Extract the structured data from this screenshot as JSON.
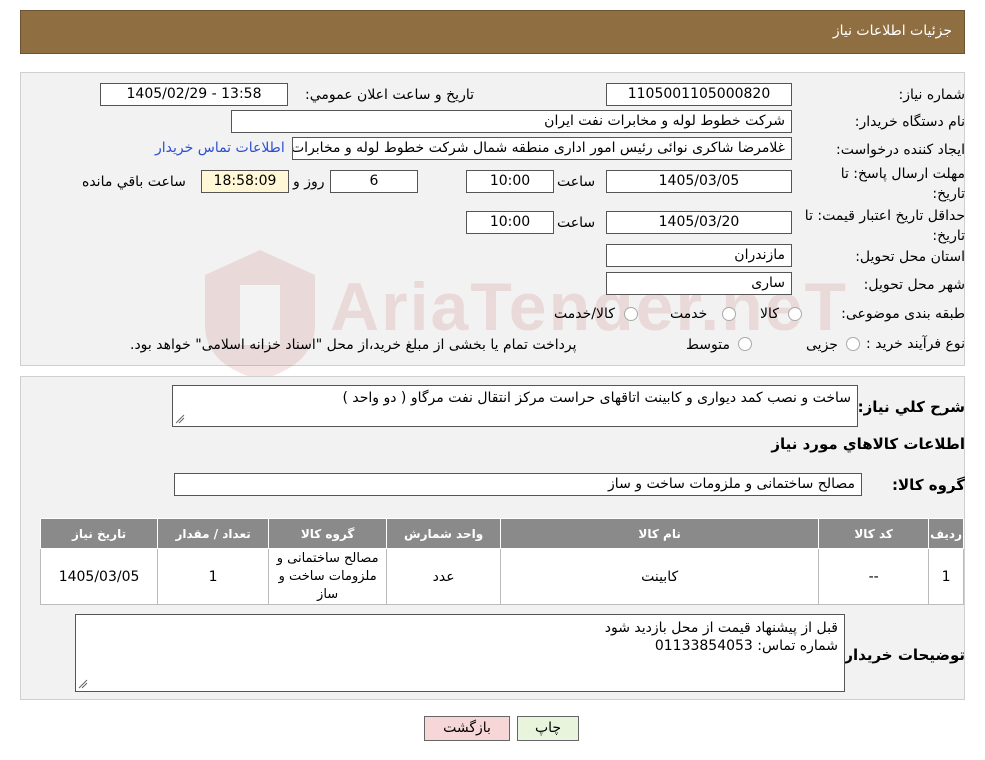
{
  "header": {
    "title": "جزئیات اطلاعات نیاز"
  },
  "form": {
    "need_number_label": "شماره نیاز:",
    "need_number": "1105001105000820",
    "announce_label": "تاریخ و ساعت اعلان عمومي:",
    "announce_value": "1405/02/29 - 13:58",
    "buyer_org_label": "نام دستگاه خریدار:",
    "buyer_org": "شرکت خطوط لوله و مخابرات نفت ایران",
    "requester_label": "ایجاد کننده درخواست:",
    "requester": "غلامرضا شاکری نوائی رئیس امور اداری منطقه شمال  شرکت خطوط لوله و مخابرات نفت ایران",
    "contact_link": "اطلاعات تماس خریدار",
    "deadline_label": "مهلت ارسال پاسخ: تا تاریخ:",
    "deadline_date": "1405/03/05",
    "time_label": "ساعت",
    "deadline_time": "10:00",
    "days_value": "6",
    "days_label": "روز و",
    "remaining_time": "18:58:09",
    "remaining_label": "ساعت باقي مانده",
    "validity_label": "حداقل تاریخ اعتبار قیمت: تا تاریخ:",
    "validity_date": "1405/03/20",
    "validity_time": "10:00",
    "province_label": "استان محل تحویل:",
    "province": "مازندران",
    "city_label": "شهر محل تحویل:",
    "city": "ساری",
    "category_label": "طبقه بندی موضوعی:",
    "category_options": [
      "کالا",
      "خدمت",
      "کالا/خدمت"
    ],
    "process_label": "نوع فرآیند خرید :",
    "process_options": [
      "جزیی",
      "متوسط"
    ],
    "process_note": "پرداخت تمام یا بخشی از مبلغ خرید،از محل \"اسناد خزانه اسلامی\" خواهد بود."
  },
  "details": {
    "summary_label": "شرح کلي نیاز:",
    "summary": "ساخت و نصب کمد دیواری و کابینت اتاقهای حراست مرکز انتقال نفت مرگاو ( دو واحد )",
    "items_heading": "اطلاعات کالاهاي مورد نیاز",
    "group_label": "گروه کالا:",
    "group_value": "مصالح ساختمانی و ملزومات ساخت و ساز",
    "table": {
      "headers": [
        "ردیف",
        "کد کالا",
        "نام کالا",
        "واحد شمارش",
        "گروه کالا",
        "تعداد / مقدار",
        "تاریخ نیاز"
      ],
      "rows": [
        [
          "1",
          "--",
          "کابینت",
          "عدد",
          "مصالح ساختمانی و ملزومات ساخت و ساز",
          "1",
          "1405/03/05"
        ]
      ]
    },
    "buyer_notes_label": "توضیحات خریدار:",
    "buyer_notes_line1": "قبل از پیشنهاد قیمت از محل بازدید شود",
    "buyer_notes_line2": "شماره تماس: 01133854053"
  },
  "buttons": {
    "print": "چاپ",
    "back": "بازگشت"
  },
  "colors": {
    "header_bg": "#8f6e42",
    "link": "#2b4fd6",
    "back_button": "#f6d6d6",
    "print_button": "#e8f5dc"
  }
}
